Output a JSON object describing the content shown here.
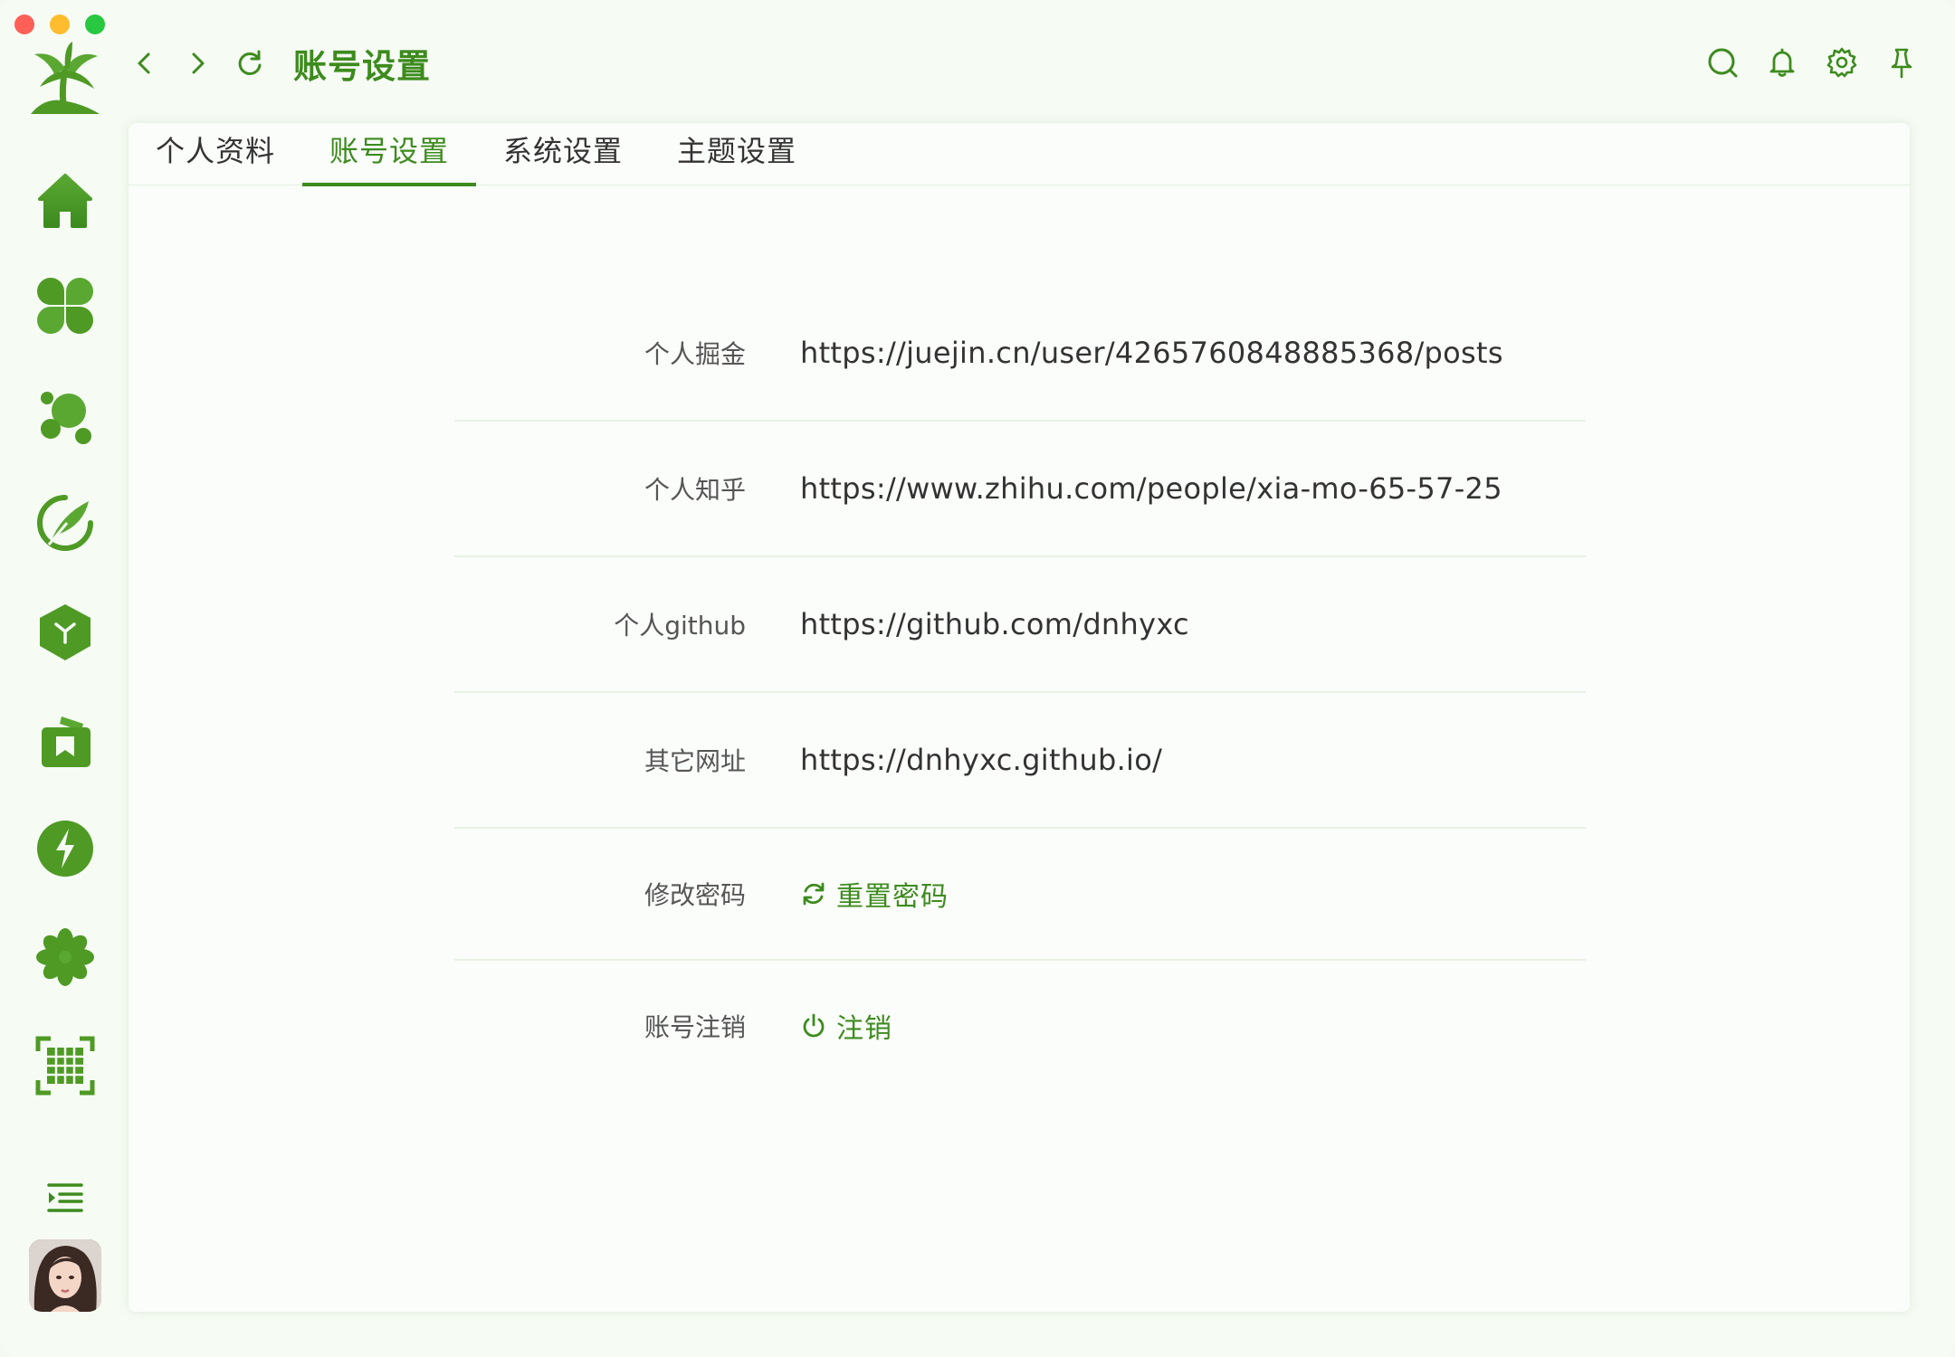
{
  "window": {
    "traffic_lights": [
      "close",
      "minimize",
      "zoom"
    ]
  },
  "colors": {
    "accent": "#3d8b1e",
    "accent_light": "#5aa832",
    "background": "#f6fbf4",
    "card": "#fbfdfa"
  },
  "sidebar": {
    "logo_icon": "palm-tree-logo",
    "items": [
      {
        "icon": "home-icon"
      },
      {
        "icon": "clover-grid-icon"
      },
      {
        "icon": "bubbles-icon"
      },
      {
        "icon": "feather-pen-icon"
      },
      {
        "icon": "cube-icon"
      },
      {
        "icon": "bookmark-folder-icon"
      },
      {
        "icon": "lightning-icon"
      },
      {
        "icon": "flower-icon"
      },
      {
        "icon": "grid-frame-icon"
      }
    ],
    "collapse_icon": "menu-collapse-icon",
    "avatar_icon": "user-avatar"
  },
  "header": {
    "title": "账号设置",
    "back_icon": "chevron-left-icon",
    "forward_icon": "chevron-right-icon",
    "refresh_icon": "refresh-icon",
    "right_icons": [
      "search-icon",
      "bell-icon",
      "gear-icon",
      "pin-icon"
    ]
  },
  "tabs": [
    {
      "label": "个人资料",
      "active": false
    },
    {
      "label": "账号设置",
      "active": true
    },
    {
      "label": "系统设置",
      "active": false
    },
    {
      "label": "主题设置",
      "active": false
    }
  ],
  "form": {
    "rows": [
      {
        "label": "个人掘金",
        "value": "https://juejin.cn/user/4265760848885368/posts"
      },
      {
        "label": "个人知乎",
        "value": "https://www.zhihu.com/people/xia-mo-65-57-25"
      },
      {
        "label": "个人github",
        "value": "https://github.com/dnhyxc"
      },
      {
        "label": "其它网址",
        "value": "https://dnhyxc.github.io/"
      }
    ],
    "password": {
      "label": "修改密码",
      "action": "重置密码",
      "icon": "refresh-icon"
    },
    "account": {
      "label": "账号注销",
      "action": "注销",
      "icon": "power-icon"
    }
  }
}
